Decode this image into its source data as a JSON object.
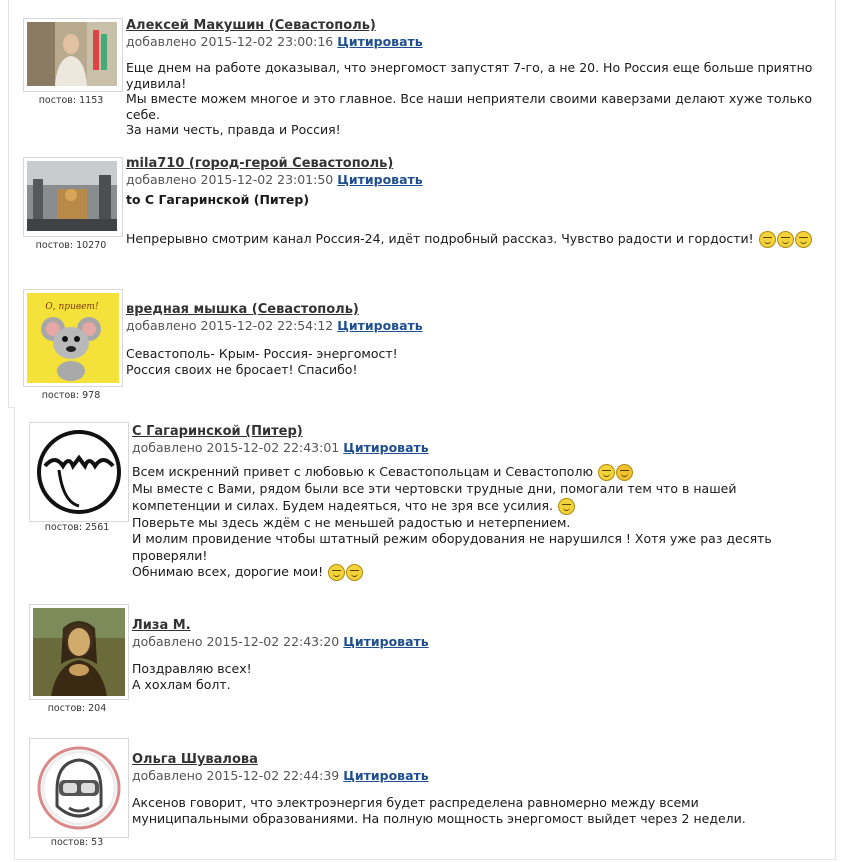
{
  "quote_label": "Цитировать",
  "posts": [
    {
      "author": "Алексей Макушин (Севастополь)",
      "date": "добавлено 2015-12-02 23:00:16",
      "postcount": "постов: 1153",
      "lines": [
        "Еще днем на работе доказывал, что энергомост запустят 7-го, а не 20. Но Россия еще больше приятно удивила!",
        "Мы вместе можем многое и это главное. Все наши неприятели своими каверзами делают хуже только себе.",
        "За нами честь, правда и Россия!"
      ]
    },
    {
      "author": "mila710 (город-герой Севастополь)",
      "date": "добавлено 2015-12-02 23:01:50",
      "postcount": "постов: 10270",
      "to_line": "to С Гагаринской (Питер)",
      "lines": [
        "Непрерывно смотрим канал Россия-24, идёт подробный рассказ. Чувство радости и гордости!"
      ]
    },
    {
      "author": "вредная мышка (Севастополь)",
      "date": "добавлено 2015-12-02 22:54:12",
      "postcount": "постов: 978",
      "avatar_text": "О, привет!",
      "lines": [
        "Севастополь- Крым- Россия- энергомост!",
        "Россия своих не бросает! Спасибо!"
      ]
    },
    {
      "author": "С Гагаринской (Питер)",
      "date": "добавлено 2015-12-02 22:43:01",
      "postcount": "постов: 2561",
      "lines": [
        "Всем искренний привет с любовью к Севастопольцам и Севастополю",
        "Мы вместе с Вами, рядом были все эти чертовски трудные дни, помогали тем что в нашей компетенции и силах. Будем надеяться, что не зря все усилия.",
        "Поверьте мы здесь ждём с не меньшей радостью и нетерпением.",
        "И молим провидение чтобы штатный режим оборудования не нарушился ! Хотя уже раз десять проверяли!",
        "Обнимаю всех, дорогие мои!"
      ]
    },
    {
      "author": "Лиза М.",
      "date": "добавлено 2015-12-02 22:43:20",
      "postcount": "постов: 204",
      "lines": [
        "Поздравляю всех!",
        "А хохлам болт."
      ]
    },
    {
      "author": "Ольга Шувалова",
      "date": "добавлено 2015-12-02 22:44:39",
      "postcount": "постов: 53",
      "lines": [
        "Аксенов говорит, что электроэнергия будет распределена равномерно между всеми муниципальными образованиями. На полную мощность энергомост выйдет через 2 недели."
      ]
    }
  ]
}
